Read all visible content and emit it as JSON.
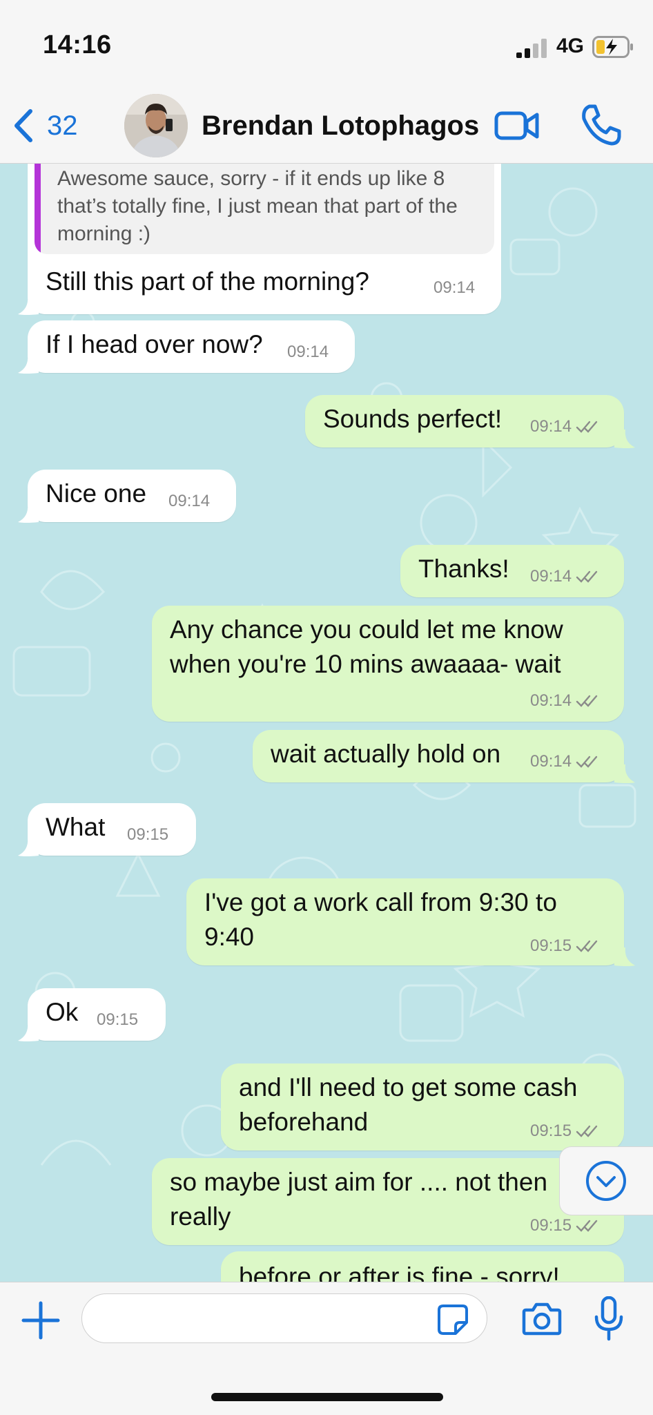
{
  "status_bar": {
    "time": "14:16",
    "network": "4G",
    "battery_charging": true
  },
  "header": {
    "back_count": "32",
    "contact_name": "Brendan Lotophagos",
    "accent_color": "#1a73d8",
    "icons": [
      "chevron-left-icon",
      "video-camera-icon",
      "phone-icon"
    ]
  },
  "quoted_message": {
    "text": "Awesome sauce, sorry - if it ends up like 8 that’s totally fine, I just mean that part of the morning :)",
    "accent_color": "#b434d8"
  },
  "messages": [
    {
      "direction": "in",
      "lines": [
        "Still this part of the morning?"
      ],
      "time": "09:14"
    },
    {
      "direction": "in",
      "lines": [
        "If I head over now?"
      ],
      "time": "09:14"
    },
    {
      "direction": "out",
      "lines": [
        "Sounds perfect!"
      ],
      "time": "09:14"
    },
    {
      "direction": "in",
      "lines": [
        "Nice one"
      ],
      "time": "09:14"
    },
    {
      "direction": "out",
      "lines": [
        "Thanks!"
      ],
      "time": "09:14"
    },
    {
      "direction": "out",
      "lines": [
        "Any chance you could let me know",
        "when you're 10 mins awaaaa- wait"
      ],
      "time": "09:14"
    },
    {
      "direction": "out",
      "lines": [
        "wait actually hold on"
      ],
      "time": "09:14"
    },
    {
      "direction": "in",
      "lines": [
        "What"
      ],
      "time": "09:15"
    },
    {
      "direction": "out",
      "lines": [
        "I've got a work call from 9:30 to",
        "9:40"
      ],
      "time": "09:15"
    },
    {
      "direction": "in",
      "lines": [
        "Ok"
      ],
      "time": "09:15"
    },
    {
      "direction": "out",
      "lines": [
        "and I'll need to get some cash",
        "beforehand"
      ],
      "time": "09:15"
    },
    {
      "direction": "out",
      "lines": [
        "so maybe just aim for .... not then",
        "really"
      ],
      "time": "09:15"
    },
    {
      "direction": "out",
      "lines": [
        "before or after is fine - sorry!"
      ],
      "time": ""
    }
  ],
  "colors": {
    "incoming_bubble": "#ffffff",
    "outgoing_bubble": "#dcf8c7",
    "chat_background": "#bfe4e8"
  },
  "composer": {
    "input_value": "",
    "icons": [
      "plus-icon",
      "sticker-icon",
      "camera-icon",
      "microphone-icon"
    ]
  },
  "scroll_button_icon": "chevron-down-circle-icon"
}
